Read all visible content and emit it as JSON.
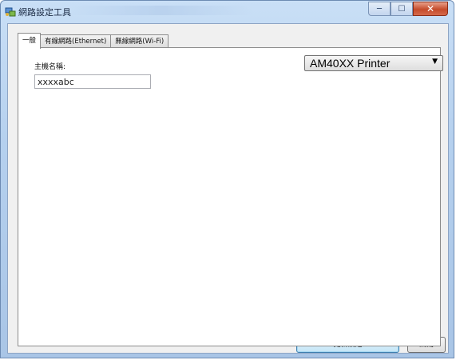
{
  "window": {
    "title": "網路設定工具",
    "close_glyph": "✕",
    "min_glyph": "─",
    "max_glyph": "☐"
  },
  "tabs": [
    {
      "label": "一般",
      "active": true
    },
    {
      "label": "有線網路(Ethernet)",
      "active": false
    },
    {
      "label": "無線網路(Wi-Fi)",
      "active": false
    }
  ],
  "general": {
    "host_label": "主機名稱:",
    "host_value": "xxxxabc",
    "printer_selected": "AM40XX Printer",
    "printer_arrow": "▼"
  },
  "buttons": {
    "update": "更新設定",
    "close": "關閉"
  },
  "colors": {
    "titlebar": "#b5d0ee",
    "close_button": "#c54b2b",
    "primary_button_border": "#3c7fb1"
  }
}
